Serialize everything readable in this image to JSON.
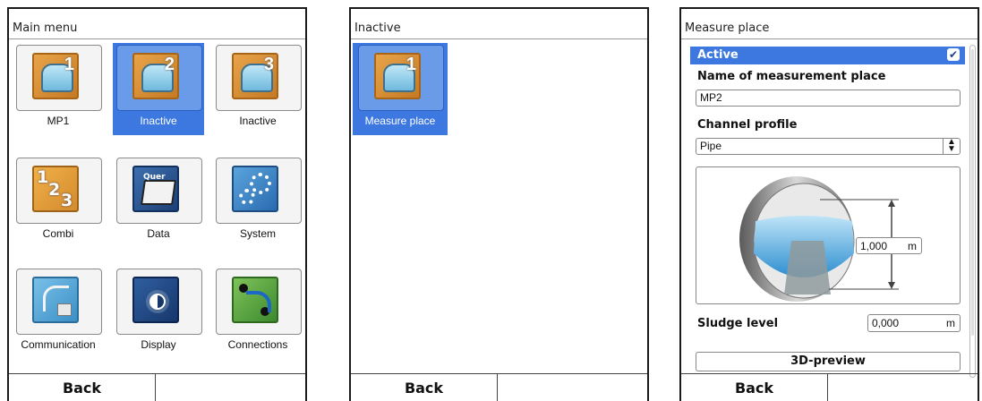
{
  "screen1": {
    "title": "Main menu",
    "tiles": [
      {
        "label": "MP1",
        "number": "1"
      },
      {
        "label": "Inactive",
        "number": "2"
      },
      {
        "label": "Inactive",
        "number": "3"
      },
      {
        "label": "Combi"
      },
      {
        "label": "Data",
        "icon_text": "Quer"
      },
      {
        "label": "System"
      },
      {
        "label": "Communication"
      },
      {
        "label": "Display"
      },
      {
        "label": "Connections"
      }
    ],
    "selected_tile": "Inactive (2)",
    "back_label": "Back"
  },
  "screen2": {
    "title": "Inactive",
    "tiles": [
      {
        "label": "Measure place",
        "number": "1"
      }
    ],
    "back_label": "Back"
  },
  "screen3": {
    "title": "Measure place",
    "active_label": "Active",
    "active_checked": true,
    "check_glyph": "✔",
    "name_label": "Name of measurement place",
    "name_value": "MP2",
    "profile_label": "Channel profile",
    "profile_value": "Pipe",
    "diameter_value": "1,000",
    "diameter_unit": "m",
    "sludge_label": "Sludge level",
    "sludge_value": "0,000",
    "sludge_unit": "m",
    "preview_button": "3D-preview",
    "back_label": "Back"
  },
  "colors": {
    "selection": "#3c78e0",
    "frame": "#1a1a1a"
  },
  "icons": [
    "measure-place-icon",
    "combi-icon",
    "data-folder-icon",
    "system-gear-icon",
    "communication-icon",
    "display-brightness-icon",
    "connections-icon",
    "pipe-3d-icon"
  ]
}
